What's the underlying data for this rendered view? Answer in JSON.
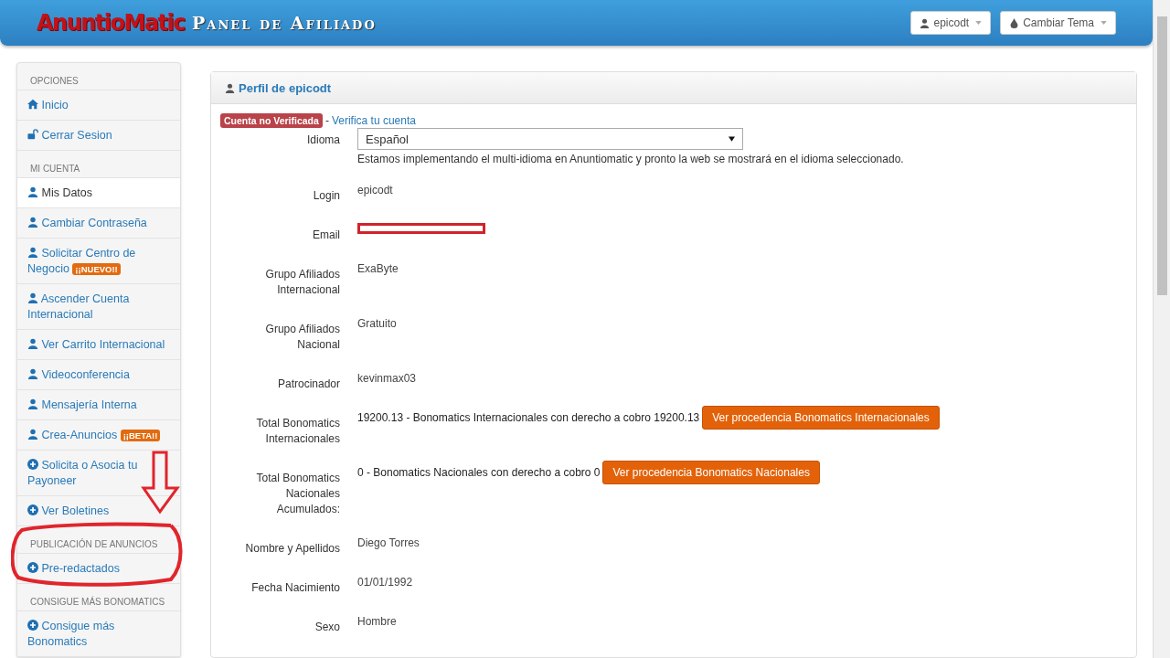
{
  "header": {
    "logo": "AnuntioMatic",
    "title": "Panel de Afiliado",
    "user_menu": "epicodt",
    "theme_menu": "Cambiar Tema"
  },
  "sidebar": {
    "items": [
      {
        "kind": "header",
        "label": "OPCIONES"
      },
      {
        "kind": "home",
        "label": "Inicio",
        "selected": false
      },
      {
        "kind": "logout",
        "label": "Cerrar Sesion",
        "selected": false
      },
      {
        "kind": "header",
        "label": "MI CUENTA"
      },
      {
        "kind": "account",
        "label": "Mis Datos",
        "selected": true
      },
      {
        "kind": "account",
        "label": "Cambiar Contraseña",
        "selected": false
      },
      {
        "kind": "account",
        "label": "Solicitar Centro de Negocio",
        "badge": "¡¡NUEVO!!",
        "selected": false
      },
      {
        "kind": "account",
        "label": "Ascender Cuenta Internacional",
        "selected": false
      },
      {
        "kind": "account",
        "label": "Ver Carrito Internacional",
        "selected": false
      },
      {
        "kind": "account",
        "label": "Videoconferencia",
        "selected": false
      },
      {
        "kind": "account",
        "label": "Mensajería Interna",
        "selected": false
      },
      {
        "kind": "account",
        "label": "Crea-Anuncios",
        "badge": "¡¡BETA!!",
        "selected": false
      },
      {
        "kind": "action",
        "label": "Solicita o Asocia tu Payoneer",
        "selected": false
      },
      {
        "kind": "action",
        "label": "Ver Boletines",
        "selected": false
      },
      {
        "kind": "header",
        "label": "PUBLICACIÓN DE ANUNCIOS"
      },
      {
        "kind": "action",
        "label": "Pre-redactados",
        "selected": false
      },
      {
        "kind": "header",
        "label": "CONSIGUE MÁS BONOMATICS"
      },
      {
        "kind": "action",
        "label": "Consigue más Bonomatics",
        "selected": false
      }
    ]
  },
  "profile": {
    "title": "Perfil de epicodt",
    "status_badge": "Cuenta no Verificada",
    "separator": "-",
    "verify_link": "Verifica tu cuenta",
    "fields": [
      {
        "kind": "select",
        "label": "Idioma",
        "value": "Español",
        "hint": "Estamos implementando el multi-idioma en Anuntiomatic y pronto la web se mostrará en el idioma seleccionado."
      },
      {
        "kind": "text",
        "label": "Login",
        "value": "epicodt"
      },
      {
        "kind": "redacted",
        "label": "Email"
      },
      {
        "kind": "text",
        "label": "Grupo Afiliados Internacional",
        "value": "ExaByte"
      },
      {
        "kind": "text",
        "label": "Grupo Afiliados Nacional",
        "value": "Gratuito"
      },
      {
        "kind": "text",
        "label": "Patrocinador",
        "value": "kevinmax03"
      },
      {
        "kind": "action",
        "label": "Total Bonomatics Internacionales",
        "value": "19200.13 - Bonomatics Internacionales con derecho a cobro 19200.13",
        "button": "Ver procedencia Bonomatics Internacionales"
      },
      {
        "kind": "action",
        "label": "Total Bonomatics Nacionales Acumulados:",
        "value": "0 - Bonomatics Nacionales con derecho a cobro 0",
        "button": "Ver procedencia Bonomatics Nacionales"
      },
      {
        "kind": "text",
        "label": "Nombre y Apellidos",
        "value": "Diego Torres"
      },
      {
        "kind": "text",
        "label": "Fecha Nacimiento",
        "value": "01/01/1992"
      },
      {
        "kind": "text",
        "label": "Sexo",
        "value": "Hombre"
      }
    ]
  }
}
